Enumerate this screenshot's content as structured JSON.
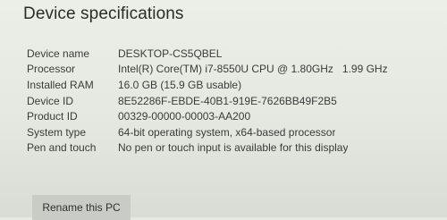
{
  "section": {
    "title": "Device specifications"
  },
  "specs": [
    {
      "label": "Device name",
      "value": "DESKTOP-CS5QBEL"
    },
    {
      "label": "Processor",
      "value": "Intel(R) Core(TM) i7-8550U CPU @ 1.80GHz   1.99 GHz"
    },
    {
      "label": "Installed RAM",
      "value": "16.0 GB (15.9 GB usable)"
    },
    {
      "label": "Device ID",
      "value": "8E52286F-EBDE-40B1-919E-7626BB49F2B5"
    },
    {
      "label": "Product ID",
      "value": "00329-00000-00003-AA200"
    },
    {
      "label": "System type",
      "value": "64-bit operating system, x64-based processor"
    },
    {
      "label": "Pen and touch",
      "value": "No pen or touch input is available for this display"
    }
  ],
  "actions": {
    "rename_label": "Rename this PC"
  }
}
